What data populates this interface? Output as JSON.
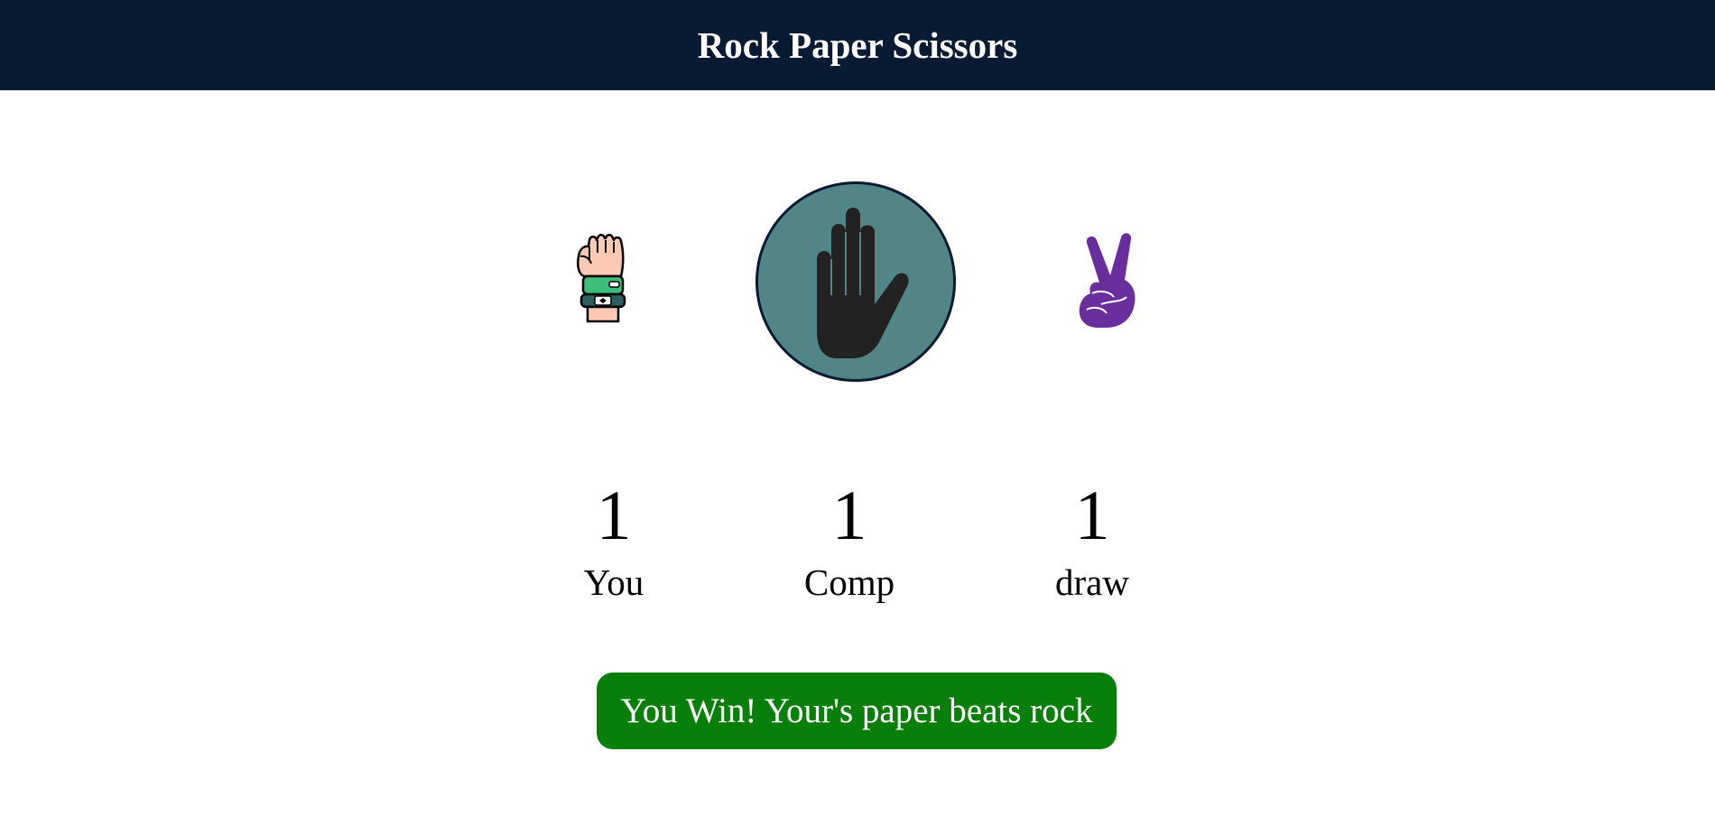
{
  "header": {
    "title": "Rock Paper Scissors"
  },
  "choices": [
    {
      "id": "rock",
      "icon": "rock-fist-icon"
    },
    {
      "id": "paper",
      "icon": "paper-hand-icon",
      "selected": true
    },
    {
      "id": "scissors",
      "icon": "scissors-peace-hand-icon"
    }
  ],
  "scores": {
    "you": {
      "value": "1",
      "label": "You"
    },
    "comp": {
      "value": "1",
      "label": "Comp"
    },
    "draw": {
      "value": "1",
      "label": "draw"
    }
  },
  "message": {
    "text": "You Win! Your's paper beats rock",
    "color": "#087f08"
  },
  "colors": {
    "header_bg": "#081b33",
    "selected_bg": "#528686",
    "hand_dark": "#222222",
    "scissors": "#6a2e9c",
    "wristband": "#3bbf7a",
    "skin": "#fccab4"
  }
}
